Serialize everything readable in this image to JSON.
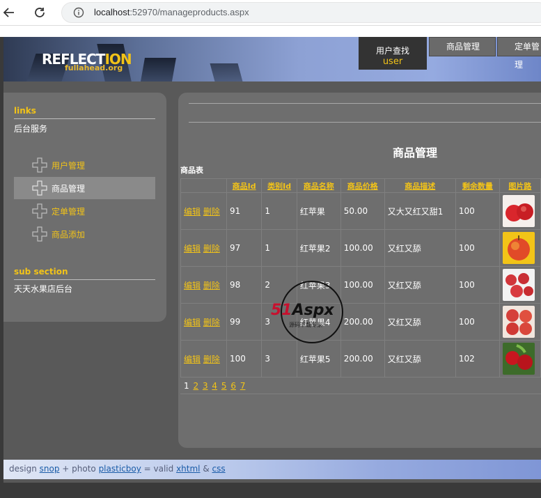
{
  "browser": {
    "url_host": "localhost",
    "url_rest": ":52970/manageproducts.aspx"
  },
  "header": {
    "logo_main": "REFLECT",
    "logo_accent": "ION",
    "logo_sub": "fullahead.org",
    "user_label": "用户查找",
    "user_name": "user",
    "tabs": [
      "商品管理",
      "定单管理"
    ]
  },
  "sidebar": {
    "links_heading": "links",
    "links_text": "后台服务",
    "items": [
      {
        "label": "用户管理",
        "active": false
      },
      {
        "label": "商品管理",
        "active": true
      },
      {
        "label": "定单管理",
        "active": false
      },
      {
        "label": "商品添加",
        "active": false
      }
    ],
    "sub_heading": "sub section",
    "sub_text": "天天水果店后台"
  },
  "content": {
    "title": "商品管理",
    "caption": "商品表",
    "columns": [
      "",
      "商品Id",
      "类别Id",
      "商品名称",
      "商品价格",
      "商品描述",
      "剩余数量",
      "图片路"
    ],
    "edit_label": "编辑",
    "delete_label": "删除",
    "rows": [
      {
        "id": "91",
        "cat": "1",
        "name": "红苹果",
        "price": "50.00",
        "desc": "又大又红又甜1",
        "qty": "100"
      },
      {
        "id": "97",
        "cat": "1",
        "name": "红苹果2",
        "price": "100.00",
        "desc": "又红又舔",
        "qty": "100"
      },
      {
        "id": "98",
        "cat": "2",
        "name": "红苹果3",
        "price": "100.00",
        "desc": "又红又舔",
        "qty": "100"
      },
      {
        "id": "99",
        "cat": "3",
        "name": "红苹果4",
        "price": "200.00",
        "desc": "又红又舔",
        "qty": "100"
      },
      {
        "id": "100",
        "cat": "3",
        "name": "红苹果5",
        "price": "200.00",
        "desc": "又红又舔",
        "qty": "102"
      }
    ],
    "pager": {
      "current": "1",
      "pages": [
        "2",
        "3",
        "4",
        "5",
        "6",
        "7"
      ]
    }
  },
  "watermark": {
    "brand_a": "51",
    "brand_b": "Aspx",
    "sub": "源码下载专家"
  },
  "footer": {
    "t1": "design ",
    "l1": "snop",
    "t2": " + photo ",
    "l2": "plasticboy",
    "t3": " = valid ",
    "l3": "xhtml",
    "t4": " & ",
    "l4": "css"
  }
}
